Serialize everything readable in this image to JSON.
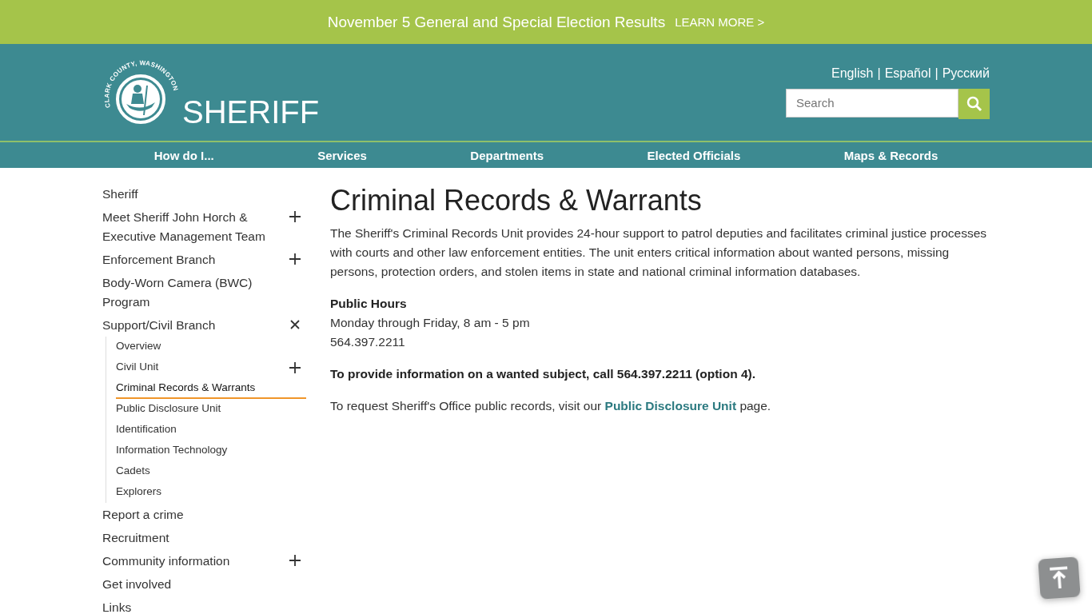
{
  "alert_bar": {
    "text": "November 5 General and Special Election Results",
    "link": "LEARN MORE >"
  },
  "header": {
    "logo_ring_text": "CLARK COUNTY, WASHINGTON",
    "site_title": "SHERIFF",
    "languages": [
      "English",
      "Español",
      "Русский"
    ],
    "language_separators": [
      "|",
      "|"
    ],
    "search": {
      "placeholder": "Search"
    }
  },
  "nav": [
    "How do I...",
    "Services",
    "Departments",
    "Elected Officials",
    "Maps & Records"
  ],
  "sidebar": {
    "items": [
      {
        "label": "Sheriff"
      },
      {
        "label": "Meet Sheriff John Horch & Executive Management Team",
        "expanded": false
      },
      {
        "label": "Enforcement Branch",
        "expanded": false
      },
      {
        "label": "Body-Worn Camera (BWC) Program"
      },
      {
        "label": "Support/Civil Branch",
        "expanded": true,
        "children": [
          {
            "label": "Overview",
            "selected": false
          },
          {
            "label": "Civil Unit",
            "selected": false,
            "expanded": false
          },
          {
            "label": "Criminal Records & Warrants",
            "selected": true
          },
          {
            "label": "Public Disclosure Unit",
            "selected": false
          },
          {
            "label": "Identification",
            "selected": false
          },
          {
            "label": "Information Technology",
            "selected": false
          },
          {
            "label": "Cadets",
            "selected": false
          },
          {
            "label": "Explorers",
            "selected": false
          }
        ]
      },
      {
        "label": "Report a crime"
      },
      {
        "label": "Recruitment"
      },
      {
        "label": "Community information",
        "expanded": false
      },
      {
        "label": "Get involved"
      },
      {
        "label": "Links"
      }
    ]
  },
  "content": {
    "title": "Criminal Records & Warrants",
    "intro": "The Sheriff's Criminal Records Unit provides 24-hour support to patrol deputies and facilitates criminal justice processes with courts and other law enforcement entities. The unit enters critical information about wanted persons, missing persons, protection orders, and stolen items in state and national criminal information databases.",
    "hours_heading": "Public Hours",
    "hours_lines": [
      "Monday through Friday, 8 am - 5 pm",
      "564.397.2211"
    ],
    "wanted_notice": "To provide information on a wanted subject, call 564.397.2211 (option 4).",
    "records_text_before": "To request Sheriff's Office public records, visit our",
    "records_link": "Public Disclosure Unit",
    "records_text_after": "page."
  }
}
